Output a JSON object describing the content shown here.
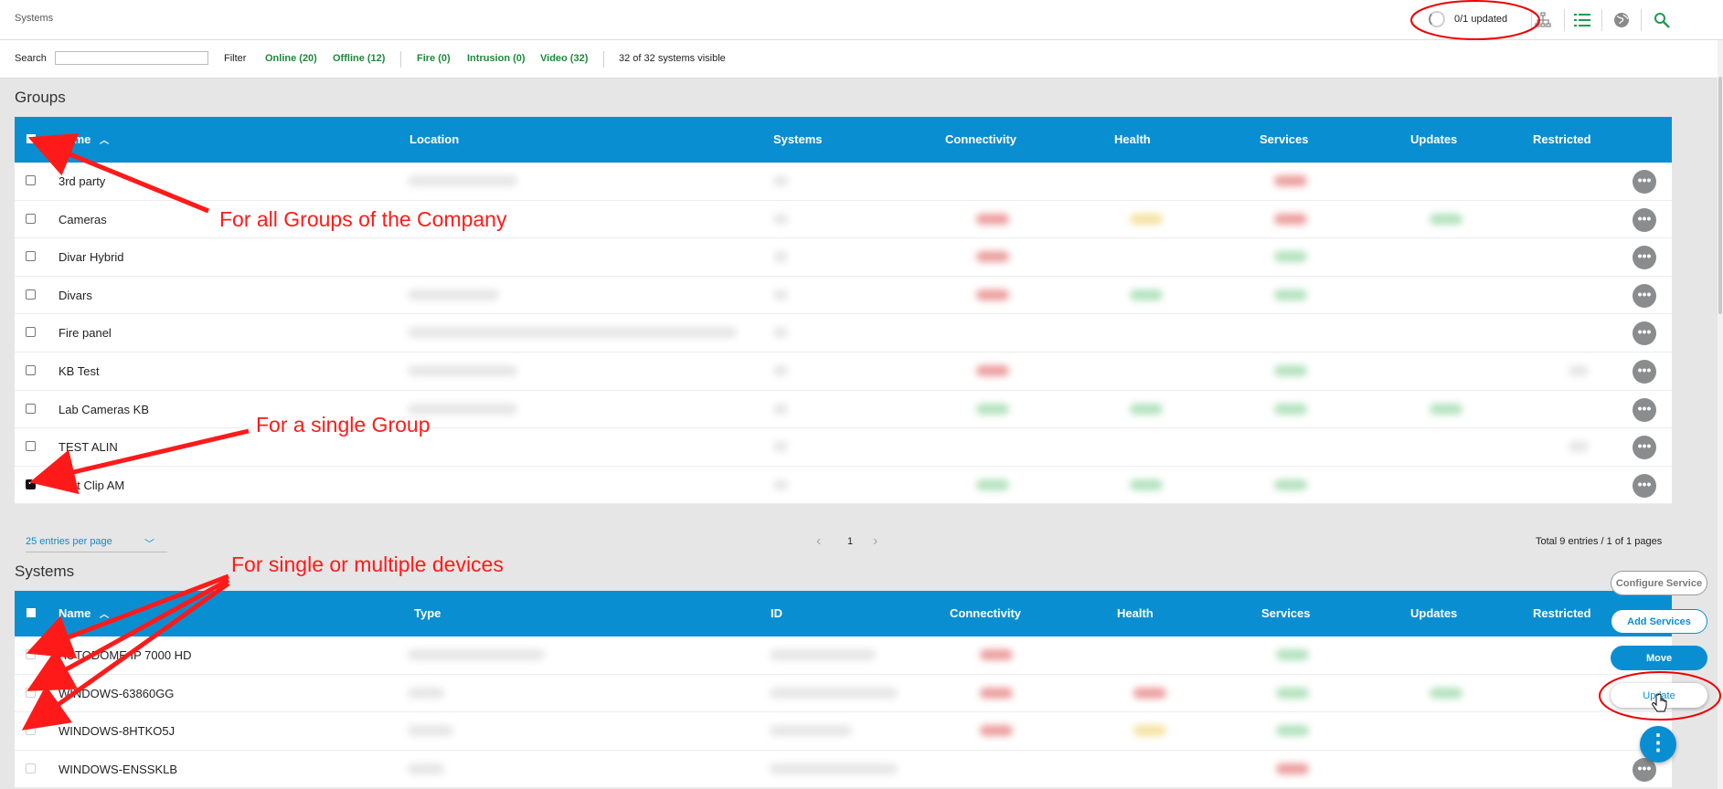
{
  "header": {
    "title": "Systems",
    "update_status": "0/1 updated"
  },
  "filterbar": {
    "search_label": "Search",
    "filter_label": "Filter",
    "filters": [
      {
        "label": "Online (20)"
      },
      {
        "label": "Offline (12)"
      },
      {
        "label": "Fire (0)"
      },
      {
        "label": "Intrusion (0)"
      },
      {
        "label": "Video (32)"
      }
    ],
    "visible_count": "32 of 32 systems visible"
  },
  "groups": {
    "title": "Groups",
    "columns": [
      "Name",
      "Location",
      "Systems",
      "Connectivity",
      "Health",
      "Services",
      "Updates",
      "Restricted"
    ],
    "rows": [
      {
        "name": "3rd party",
        "checked": false
      },
      {
        "name": "Cameras",
        "checked": false
      },
      {
        "name": "Divar Hybrid",
        "checked": false
      },
      {
        "name": "Divars",
        "checked": false
      },
      {
        "name": "Fire panel",
        "checked": false
      },
      {
        "name": "KB Test",
        "checked": false
      },
      {
        "name": "Lab Cameras KB",
        "checked": false
      },
      {
        "name": "TEST ALIN",
        "checked": false
      },
      {
        "name": "Test Clip AM",
        "checked": true
      }
    ]
  },
  "pagination": {
    "per_page": "25 entries per page",
    "prev": "‹",
    "page": "1",
    "next": "›",
    "total": "Total 9 entries / 1 of 1 pages"
  },
  "systems": {
    "title": "Systems",
    "columns": [
      "Name",
      "Type",
      "ID",
      "Connectivity",
      "Health",
      "Services",
      "Updates",
      "Restricted"
    ],
    "rows": [
      {
        "name": "AUTODOME IP 7000 HD"
      },
      {
        "name": "WINDOWS-63860GG"
      },
      {
        "name": "WINDOWS-8HTKO5J"
      },
      {
        "name": "WINDOWS-ENSSKLB"
      }
    ]
  },
  "actions": {
    "configure_service": "Configure Service",
    "add_services": "Add Services",
    "move": "Move",
    "update": "Update",
    "more": "⋮",
    "row_more": "•••"
  },
  "annotations": {
    "all_groups": "For all Groups of the Company",
    "single_group": "For a single Group",
    "devices": "For single or multiple devices"
  },
  "colors": {
    "header_blue": "#0a8ed2",
    "filter_green": "#1b8a3a",
    "annotation_red": "#ff1a1a"
  }
}
